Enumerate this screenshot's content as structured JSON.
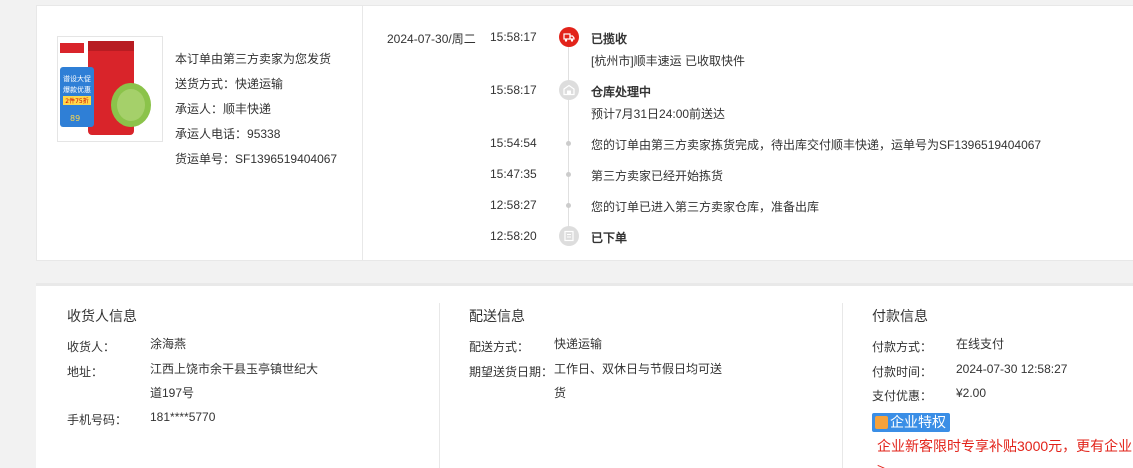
{
  "shipment": {
    "note": "本订单由第三方卖家为您发货",
    "method_label": "送货方式：",
    "method_value": "快递运输",
    "carrier_label": "承运人：",
    "carrier_value": "顺丰快递",
    "phone_label": "承运人电话：",
    "phone_value": "95338",
    "tracking_label": "货运单号：",
    "tracking_value": "SF1396519404067"
  },
  "product_image": {
    "promo_text_1": "谱设大促",
    "promo_text_2": "爆款优惠",
    "promo_text_3": "2件75折",
    "price": "89",
    "colors": {
      "can": "#d9242a",
      "badge": "#3a8ee6",
      "leaf": "#7fb63a"
    }
  },
  "timeline": [
    {
      "date": "2024-07-30/周二",
      "time": "15:58:17",
      "title": "已揽收",
      "desc": "[杭州市]顺丰速运 已收取快件",
      "icon": "truck-icon",
      "active": true
    },
    {
      "date": "",
      "time": "15:58:17",
      "title": "仓库处理中",
      "desc": "预计7月31日24:00前送达",
      "icon": "warehouse-icon",
      "active": false
    },
    {
      "date": "",
      "time": "15:54:54",
      "title": "",
      "desc": "您的订单由第三方卖家拣货完成，待出库交付顺丰快递，运单号为SF1396519404067",
      "icon": "dot",
      "active": false
    },
    {
      "date": "",
      "time": "15:47:35",
      "title": "",
      "desc": "第三方卖家已经开始拣货",
      "icon": "dot",
      "active": false
    },
    {
      "date": "",
      "time": "12:58:27",
      "title": "",
      "desc": "您的订单已进入第三方卖家仓库，准备出库",
      "icon": "dot",
      "active": false
    },
    {
      "date": "",
      "time": "12:58:20",
      "title": "已下单",
      "desc": "",
      "icon": "order-icon",
      "active": false
    }
  ],
  "receiver": {
    "title": "收货人信息",
    "name_label": "收货人：",
    "name_value": "涂海燕",
    "address_label": "地址：",
    "address_line1": "江西上饶市余干县玉亭镇世纪大",
    "address_line2": "道197号",
    "phone_label": "手机号码：",
    "phone_value": "181****5770"
  },
  "delivery": {
    "title": "配送信息",
    "method_label": "配送方式：",
    "method_value": "快递运输",
    "date_label": "期望送货日期：",
    "date_line1": "工作日、双休日与节假日均可送",
    "date_line2": "货"
  },
  "payment": {
    "title": "付款信息",
    "method_label": "付款方式：",
    "method_value": "在线支付",
    "time_label": "付款时间：",
    "time_value": "2024-07-30 12:58:27",
    "discount_label": "支付优惠：",
    "discount_value": "¥2.00",
    "badge": "企业特权",
    "promo_line1": "企业新客限时专享补贴3000元，更有企业",
    "promo_line2": ">"
  },
  "colors": {
    "accent_red": "#e2231a",
    "badge_blue": "#3a8ee6",
    "muted_gray": "#dddddd"
  }
}
